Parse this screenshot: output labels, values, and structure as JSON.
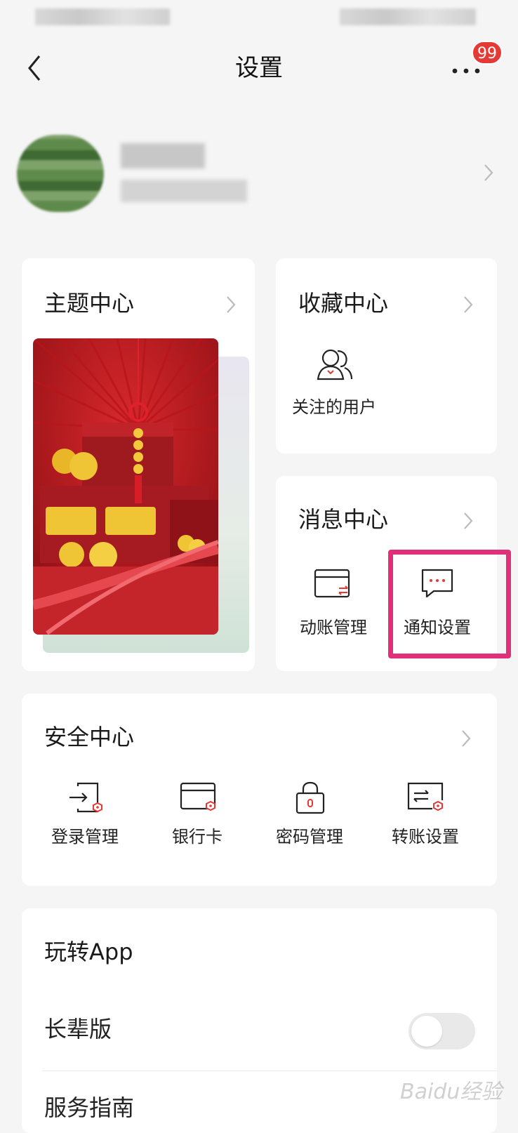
{
  "header": {
    "title": "设置",
    "more_badge": "99"
  },
  "cards": {
    "theme": {
      "title": "主题中心"
    },
    "favorites": {
      "title": "收藏中心",
      "items": [
        {
          "label": "关注的用户",
          "icon": "followed-users-icon"
        }
      ]
    },
    "messages": {
      "title": "消息中心",
      "items": [
        {
          "label": "动账管理",
          "icon": "account-activity-icon"
        },
        {
          "label": "通知设置",
          "icon": "chat-bubble-icon"
        }
      ]
    },
    "security": {
      "title": "安全中心",
      "items": [
        {
          "label": "登录管理",
          "icon": "login-manage-icon"
        },
        {
          "label": "银行卡",
          "icon": "bank-card-icon"
        },
        {
          "label": "密码管理",
          "icon": "padlock-icon"
        },
        {
          "label": "转账设置",
          "icon": "transfer-settings-icon"
        }
      ]
    },
    "app": {
      "title": "玩转App",
      "rows": [
        {
          "label": "长辈版",
          "toggle": false
        },
        {
          "label": "服务指南"
        }
      ]
    }
  },
  "watermark": "Baidu经验",
  "colors": {
    "accent": "#e53935",
    "highlight": "#e0307a"
  }
}
